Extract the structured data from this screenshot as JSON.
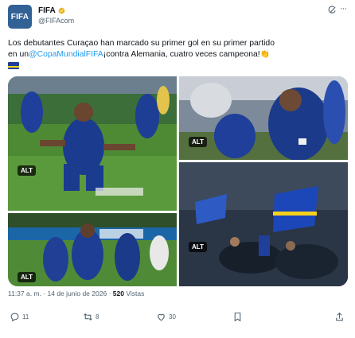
{
  "author": {
    "avatar_text": "FIFA",
    "display_name": "FIFA",
    "handle": "@FIFAcom",
    "verified_color": "#e8b517"
  },
  "tweet": {
    "text_line1": "Los debutantes Curaçao han marcado su primer gol en su primer partido",
    "text_line2_prefix": "en un",
    "mention": "@CopaMundialFIFA",
    "text_line2_suffix": "¡contra Alemania, cuatro veces campeona!",
    "emoji": "👏",
    "flag_icon": "curacao-flag-icon"
  },
  "media": {
    "alt_label": "ALT",
    "photos": [
      {
        "name": "photo-celebration-slide",
        "alt": "ALT"
      },
      {
        "name": "photo-player-closeup",
        "alt": "ALT"
      },
      {
        "name": "photo-teammates-celebrate",
        "alt": "ALT"
      },
      {
        "name": "photo-crowd-flags",
        "alt": "ALT"
      }
    ]
  },
  "meta": {
    "time": "11:37 a. m.",
    "separator": "·",
    "date": "14 de junio de 2026",
    "views_count": "520",
    "views_label": "Vistas"
  },
  "actions": {
    "reply_count": "11",
    "retweet_count": "8",
    "like_count": "30"
  },
  "colors": {
    "link": "#1d9bf0",
    "secondary_text": "#536471",
    "brand": "#326295"
  }
}
